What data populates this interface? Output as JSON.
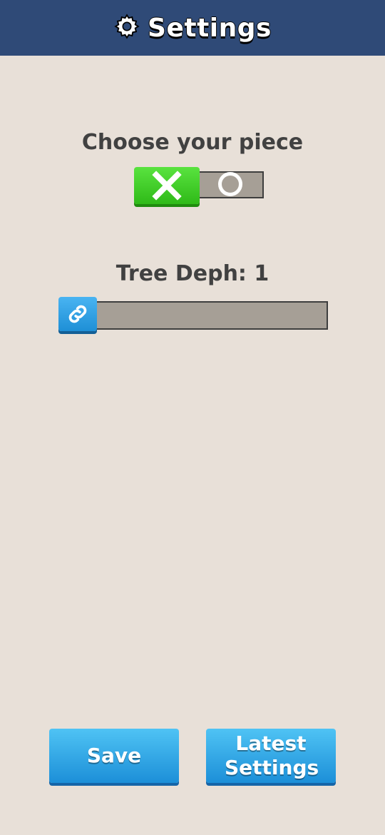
{
  "header": {
    "title": "Settings",
    "icon": "gear-icon"
  },
  "piece": {
    "label": "Choose your piece",
    "options": [
      "X",
      "O"
    ],
    "selected": "X"
  },
  "depth": {
    "label": "Tree Deph: 1",
    "value": 1,
    "handle_icon": "link-icon"
  },
  "buttons": {
    "save": "Save",
    "latest": "Latest Settings"
  },
  "colors": {
    "header": "#2f4a77",
    "background": "#e8e0d8",
    "toggle_active": "#3fcf2a",
    "slider_handle": "#2a9fe6",
    "button": "#34aae8",
    "track": "#a69f96"
  }
}
